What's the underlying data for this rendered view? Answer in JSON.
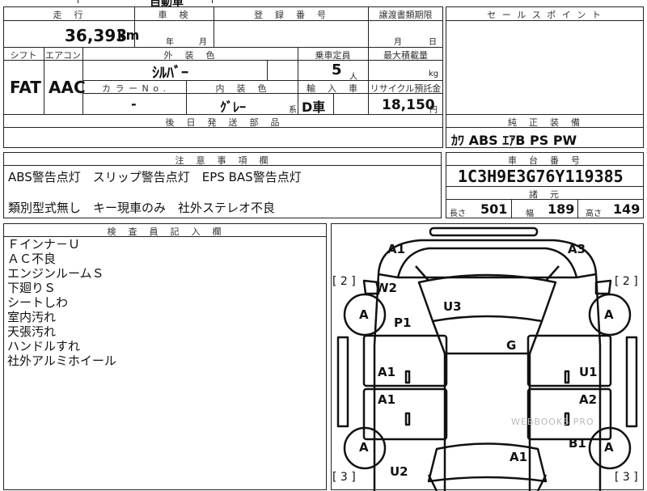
{
  "top_fragment": "自動車",
  "mileage": {
    "header": "走　行",
    "value": "36,393",
    "unit": "km"
  },
  "inspection": {
    "header": "車　検",
    "year_unit": "年",
    "month_unit": "月"
  },
  "registration": {
    "header": "登　録　番　号"
  },
  "transfer_deadline": {
    "header": "譲渡書類期限",
    "month_unit": "月",
    "day_unit": "日"
  },
  "shift": {
    "header": "シフト",
    "value": "FAT"
  },
  "aircon": {
    "header": "エアコン",
    "value": "AAC"
  },
  "exterior_color": {
    "header": "外　装　色",
    "value": "ｼﾙﾊﾞｰ"
  },
  "color_no": {
    "header": "カ ラ ー N o .",
    "value": "-"
  },
  "interior_color": {
    "header": "内　装　色",
    "value": "ｸﾞﾚｰ",
    "suffix": "系"
  },
  "capacity": {
    "header": "乗車定員",
    "value": "5",
    "unit": "人"
  },
  "max_load": {
    "header": "最大積載量",
    "unit": "kg"
  },
  "import": {
    "header": "輸　入　車",
    "value": "D車"
  },
  "recycle": {
    "header": "リサイクル預託金",
    "value": "18,150",
    "unit": "円"
  },
  "later_parts": {
    "header": "後　日　発　送　部　品"
  },
  "sales_point": {
    "header": "セ ー ル ス ポ イ ン ト"
  },
  "equipment": {
    "header": "純　正　装　備",
    "value": "ｶﾜ ABS ｴｱB PS PW"
  },
  "notes": {
    "header": "注　意　事　項　欄",
    "line1": "ABS警告点灯　スリップ警告点灯　EPS BAS警告点灯",
    "line2": "類別型式無し　キー現車のみ　社外ステレオ不良"
  },
  "chassis": {
    "header": "車　台　番　号",
    "value": "1C3H9E3G76Y119385"
  },
  "dimensions": {
    "header": "諸　元",
    "length_label": "長さ",
    "length": "501",
    "width_label": "幅",
    "width": "189",
    "height_label": "高さ",
    "height": "149"
  },
  "inspector": {
    "header": "検　査　員　記　入　欄",
    "lines": [
      "Ｆインナ－Ｕ",
      "ＡＣ不良",
      "エンジンルームＳ",
      "下廻りＳ",
      "シートしわ",
      "室内汚れ",
      "天張汚れ",
      "ハンドルすれ",
      "社外アルミホイール"
    ]
  },
  "diagram": {
    "marks": {
      "a1_top": "A1",
      "a3_top": "A3",
      "w2": "W2",
      "u3": "U3",
      "p1": "P1",
      "g": "G",
      "a1_left_mid": "A1",
      "a1_left_low": "A1",
      "u1": "U1",
      "a2": "A2",
      "b1": "B1",
      "a1_bottom": "A1",
      "u2": "U2",
      "wheel_fl": "A",
      "wheel_fr": "A",
      "wheel_rl": "A",
      "wheel_rr": "A"
    },
    "bracket_fl": "[ 2 ]",
    "bracket_fr": "[ 2 ]",
    "bracket_rl": "[ 3 ]",
    "bracket_rr": "[ 3 ]",
    "watermark": "WEBBOOKS PRO"
  }
}
